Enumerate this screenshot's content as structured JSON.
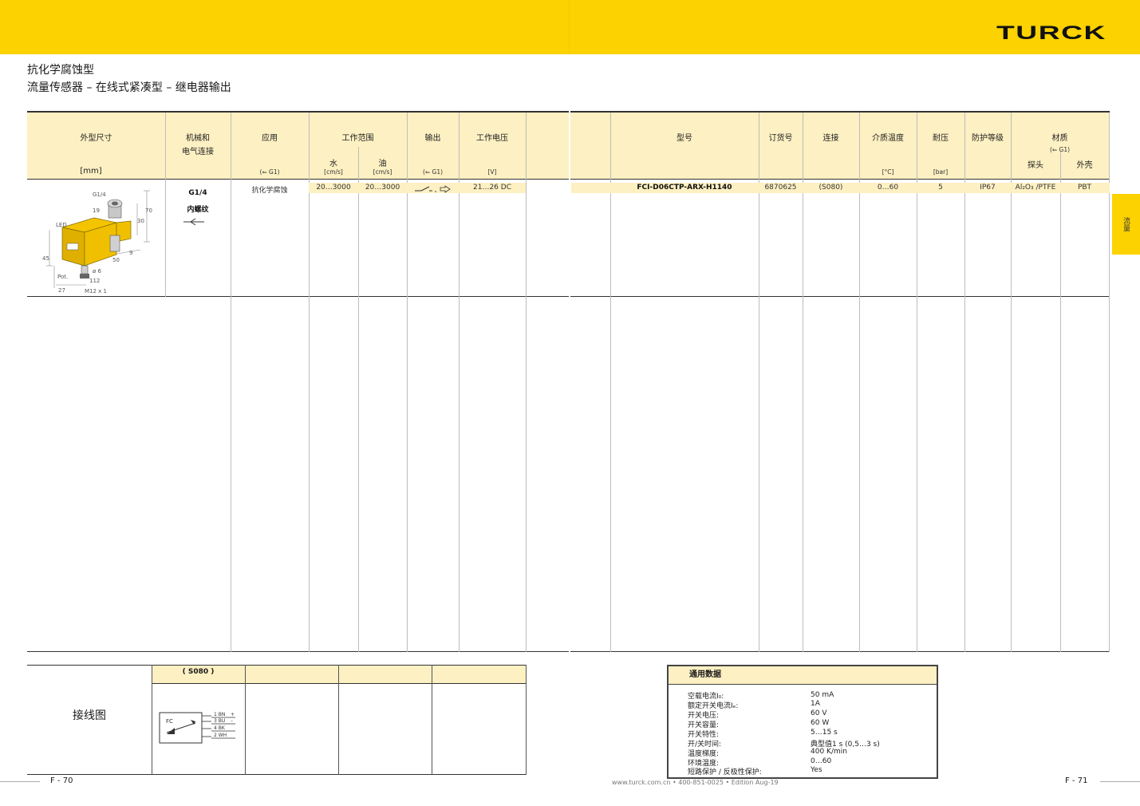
{
  "brand": {
    "logo": "TURCK",
    "color": "#fcd200",
    "header_fill": "#fdf0c2"
  },
  "title": {
    "line1": "抗化学腐蚀型",
    "line2": "流量传感器 – 在线式紧凑型 – 继电器输出"
  },
  "side_tab": "流量",
  "headers": {
    "dimensions": "外型尺寸",
    "dimensions_unit": "[mm]",
    "mech": "机械和",
    "elec": "电气连接",
    "app": "应用",
    "app_note": "(⇐ G1)",
    "range": "工作范围",
    "water": "水",
    "water_unit": "[cm/s]",
    "oil": "油",
    "oil_unit": "[cm/s]",
    "output": "输出",
    "output_note": "(⇐ G1)",
    "voltage": "工作电压",
    "voltage_unit": "[V]",
    "model": "型号",
    "order": "订货号",
    "conn": "连接",
    "temp": "介质温度",
    "temp_unit": "[°C]",
    "pressure": "耐压",
    "pressure_unit": "[bar]",
    "protection": "防护等级",
    "material": "材质",
    "material_note": "(⇐ G1)",
    "probe": "探头",
    "housing": "外壳"
  },
  "product": {
    "thread": "G1/4",
    "thread_type": "内螺纹",
    "application": "抗化学腐蚀",
    "water_range": "20…3000",
    "oil_range": "20…3000",
    "voltage": "21…26 DC",
    "model": "FCI-D06CTP-ARX-H1140",
    "order_no": "6870625",
    "connection": "(S080)",
    "temp": "0…60",
    "pressure": "5",
    "protection": "IP67",
    "probe_material": "Al₂O₃ /PTFE",
    "housing_material": "PBT"
  },
  "drawing_labels": {
    "g14": "G1/4",
    "d19": "19",
    "d70": "70",
    "d30": "30",
    "led": "LED",
    "d45": "45",
    "d50": "50",
    "d9": "9",
    "d6": "ø 6",
    "pot": "Pot.",
    "d112": "112",
    "d27": "27",
    "m12": "M12 x 1"
  },
  "wiring": {
    "title": "接线图",
    "header": "( S080 )",
    "fc": "FC",
    "pins": [
      "1 BN",
      "3 BU",
      "4 BK",
      "2 WH"
    ],
    "signs": [
      "+",
      "–"
    ]
  },
  "general_data": {
    "title": "通用数据",
    "rows": [
      {
        "label": "空载电流I₀:",
        "value": "50 mA"
      },
      {
        "label": "额定开关电流Iₑ:",
        "value": "1A"
      },
      {
        "label": "开关电压:",
        "value": "60 V"
      },
      {
        "label": "开关容量:",
        "value": "60 W"
      },
      {
        "label": "开关特性:",
        "value": "5…15 s"
      },
      {
        "label": "开/关时间:",
        "value": "典型值1 s (0,5…3 s)"
      },
      {
        "label": "温度梯度:",
        "value": "400 K/min"
      },
      {
        "label": "环境温度:",
        "value": "0…60"
      },
      {
        "label": "短路保护 / 反极性保护:",
        "value": "Yes"
      }
    ]
  },
  "footer": {
    "left": "F - 70",
    "center": "www.turck.com.cn • 400-851-0025 • Edition Aug-19",
    "right": "F - 71"
  }
}
